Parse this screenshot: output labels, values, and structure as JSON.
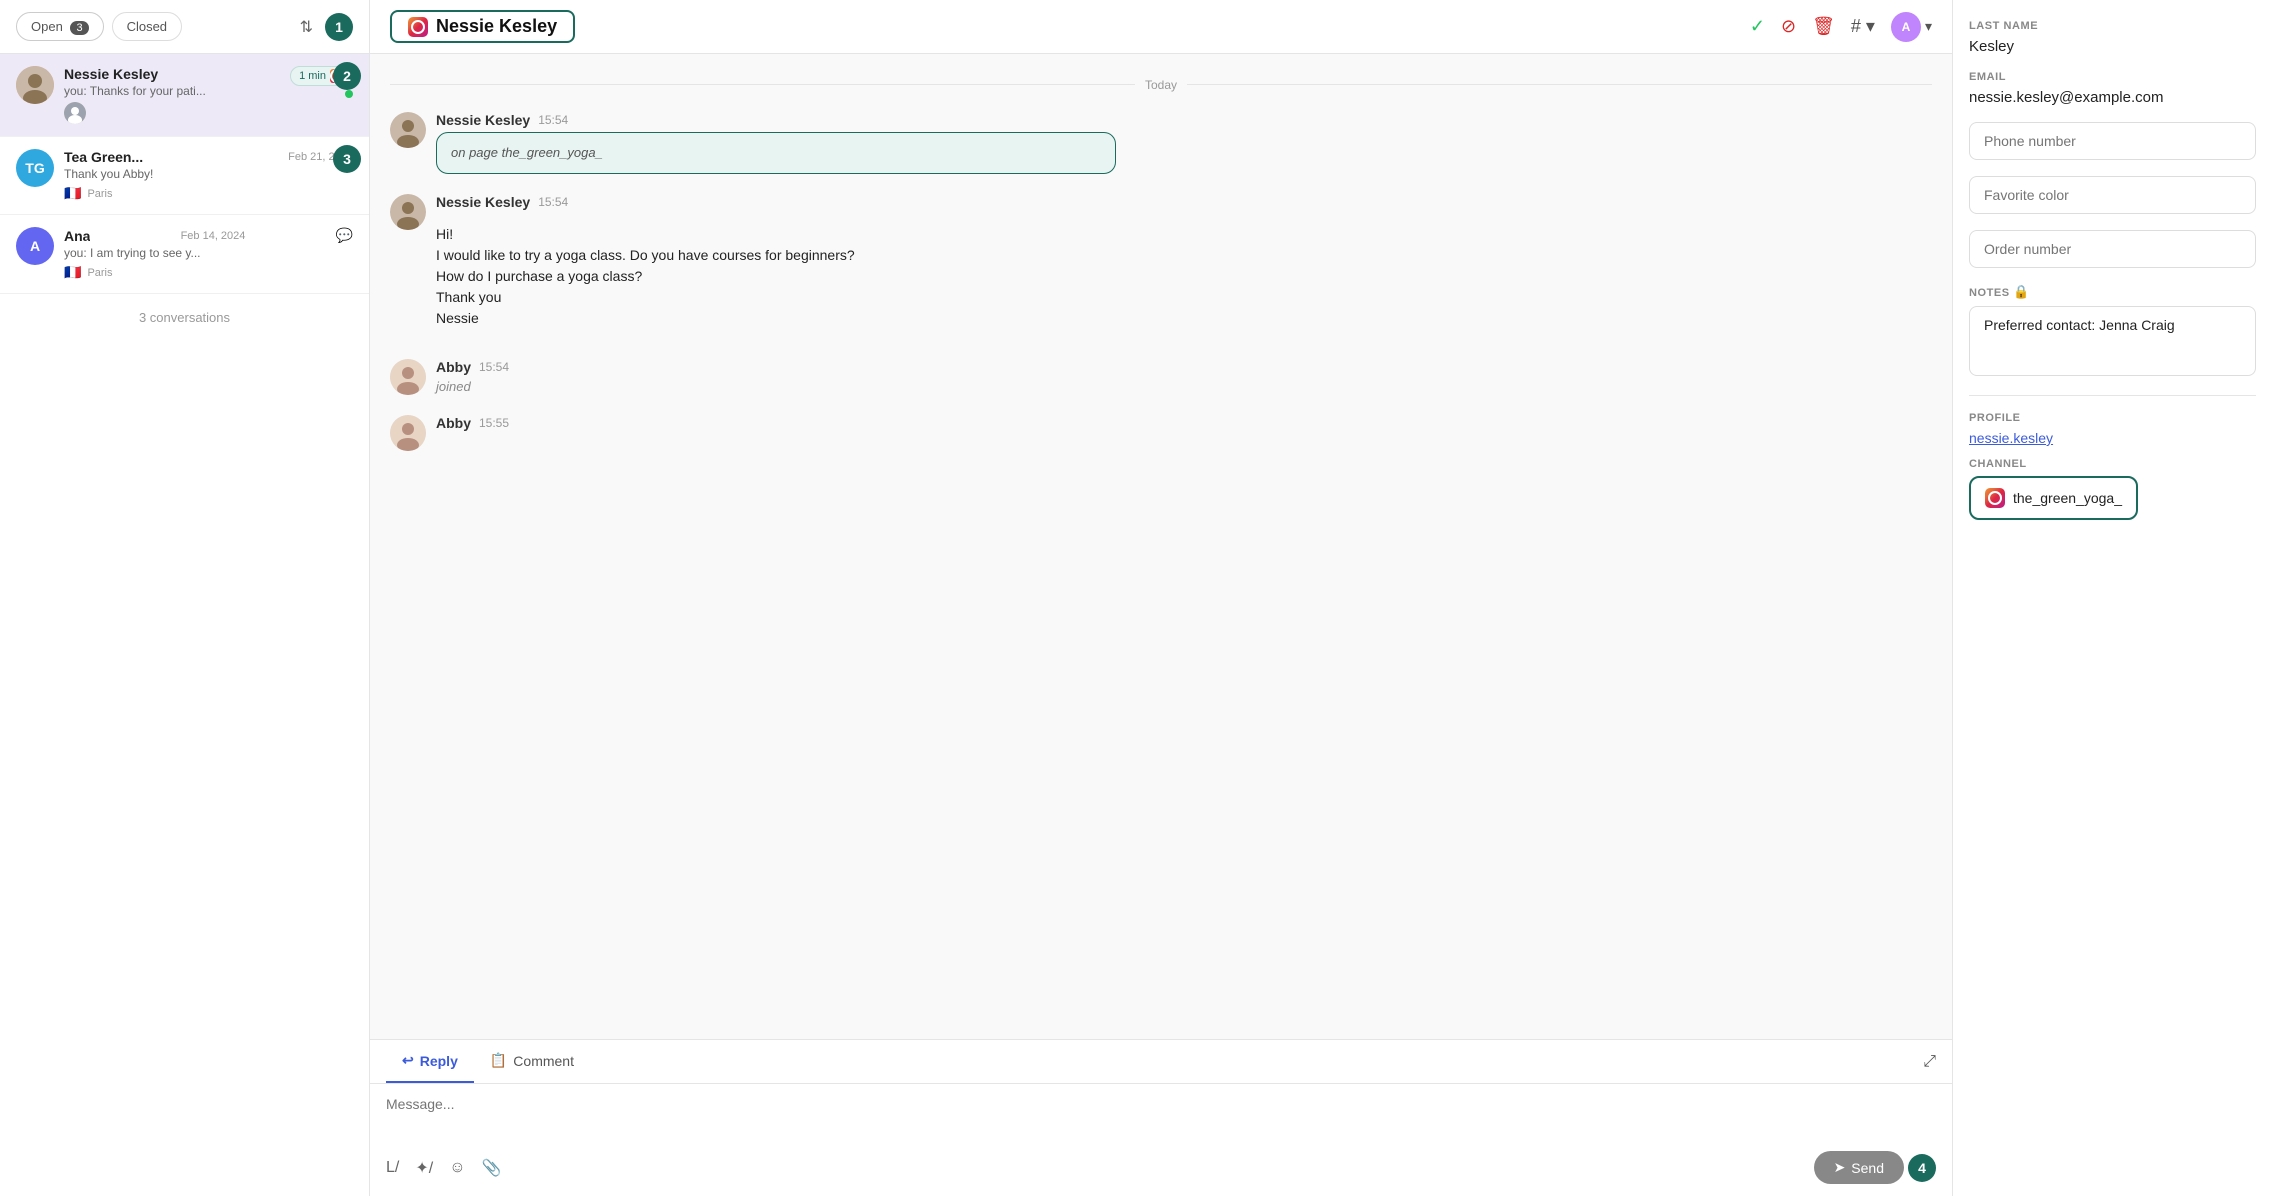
{
  "sidebar": {
    "tabs": [
      {
        "label": "Open",
        "badge": "3",
        "active": true
      },
      {
        "label": "Closed",
        "badge": null,
        "active": false
      }
    ],
    "conversations": [
      {
        "id": "nessie",
        "name": "Nessie Kesley",
        "time": "1 min",
        "channel": "instagram",
        "preview": "you: Thanks for your pati...",
        "active": true,
        "hasAvatar": true,
        "step": "2"
      },
      {
        "id": "tea",
        "name": "Tea Green...",
        "time": "Feb 21, 2024",
        "channel": null,
        "preview": "Thank you Abby!",
        "flag": "🇫🇷",
        "city": "Paris",
        "active": false,
        "hasAvatar": false,
        "initials": "TG",
        "avatarColor": "#2fa8e0",
        "step": "3"
      },
      {
        "id": "ana",
        "name": "Ana",
        "time": "Feb 14, 2024",
        "channel": null,
        "preview": "you: I am trying to see y...",
        "flag": "🇫🇷",
        "city": "Paris",
        "active": false,
        "hasAvatar": false,
        "initials": "A",
        "avatarColor": "#6366f1",
        "hasComment": true
      }
    ],
    "count_label": "3 conversations"
  },
  "chat": {
    "contact_name": "Nessie Kesley",
    "date_divider": "Today",
    "messages": [
      {
        "id": "msg1",
        "sender": "Nessie Kesley",
        "time": "15:54",
        "sub": "on page the_green_yoga_",
        "content": null,
        "highlighted": true
      },
      {
        "id": "msg2",
        "sender": "Nessie Kesley",
        "time": "15:54",
        "content": "Hi!\nI would like to try a yoga class. Do you have courses for beginners?\nHow do I purchase a yoga class?\nThank you\nNessie",
        "highlighted": false
      },
      {
        "id": "msg3",
        "sender": "Abby",
        "time": "15:54",
        "content": "joined",
        "joined": true,
        "highlighted": false
      },
      {
        "id": "msg4",
        "sender": "Abby",
        "time": "15:55",
        "content": null,
        "truncated": true,
        "highlighted": false
      }
    ]
  },
  "reply_box": {
    "tabs": [
      {
        "label": "Reply",
        "active": true,
        "icon": "↩"
      },
      {
        "label": "Comment",
        "active": false,
        "icon": "📋"
      }
    ],
    "placeholder": "Message...",
    "send_label": "Send"
  },
  "right_panel": {
    "last_name_label": "LAST NAME",
    "last_name_value": "Kesley",
    "email_label": "EMAIL",
    "email_value": "nessie.kesley@example.com",
    "phone_placeholder": "Phone number",
    "favorite_color_placeholder": "Favorite color",
    "order_number_placeholder": "Order number",
    "notes_label": "NOTES",
    "notes_value": "Preferred contact: Jenna Craig",
    "profile_label": "PROFILE",
    "profile_link": "nessie.kesley",
    "channel_label": "CHANNEL",
    "channel_name": "the_green_yoga_",
    "step4_badge": "4"
  }
}
